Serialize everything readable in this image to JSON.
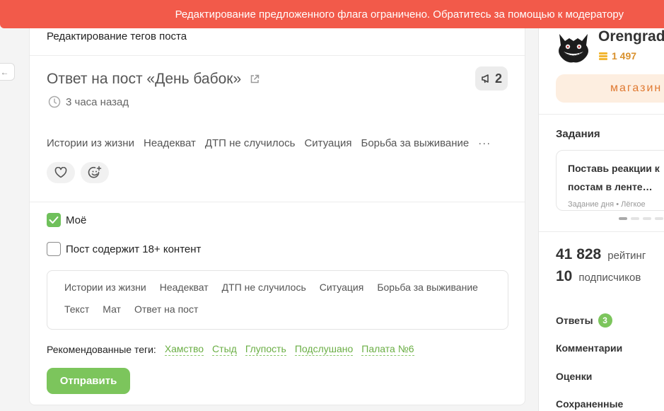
{
  "banner": {
    "text": "Редактирование предложенного флага ограничено. Обратитесь за помощью к модератору"
  },
  "nav": {
    "back_icon": "arrow-left-icon",
    "back_glyph": "←"
  },
  "editor": {
    "heading": "Редактирование тегов поста",
    "post_title": "Ответ на пост «День бабок»",
    "comments_count": "2",
    "time_ago": "3 часа назад",
    "post_tags": [
      "Истории из жизни",
      "Неадекват",
      "ДТП не случилось",
      "Ситуация",
      "Борьба за выживание"
    ],
    "more_glyph": "···",
    "checkbox_mine": {
      "label": "Моё",
      "checked": true
    },
    "checkbox_nsfw": {
      "label": "Пост содержит 18+ контент",
      "checked": false
    },
    "edit_tags": [
      "Истории из жизни",
      "Неадекват",
      "ДТП не случилось",
      "Ситуация",
      "Борьба за выживание",
      "Текст",
      "Мат",
      "Ответ на пост"
    ],
    "recommended_label": "Рекомендованные теги:",
    "recommended_tags": [
      "Хамство",
      "Стыд",
      "Глупость",
      "Подслушано",
      "Палата №6"
    ],
    "submit_label": "Отправить"
  },
  "profile": {
    "username": "Orengrad",
    "coins": "1 497",
    "shop_label": "магазин"
  },
  "tasks": {
    "heading": "Задания",
    "task_title_line1": "Поставь реакции к",
    "task_title_line2": "постам в ленте…",
    "task_meta": "Задание дня  •  Лёгкое"
  },
  "stats": {
    "rating_value": "41 828",
    "rating_label": "рейтинг",
    "subscribers_value": "10",
    "subscribers_label": "подписчиков"
  },
  "links": {
    "answers": "Ответы",
    "answers_badge": "3",
    "comments": "Комментарии",
    "ratings": "Оценки",
    "saved": "Сохраненные"
  },
  "colors": {
    "banner": "#f25a4a",
    "accent_green": "#7cc55c",
    "coin": "#d9912d"
  }
}
